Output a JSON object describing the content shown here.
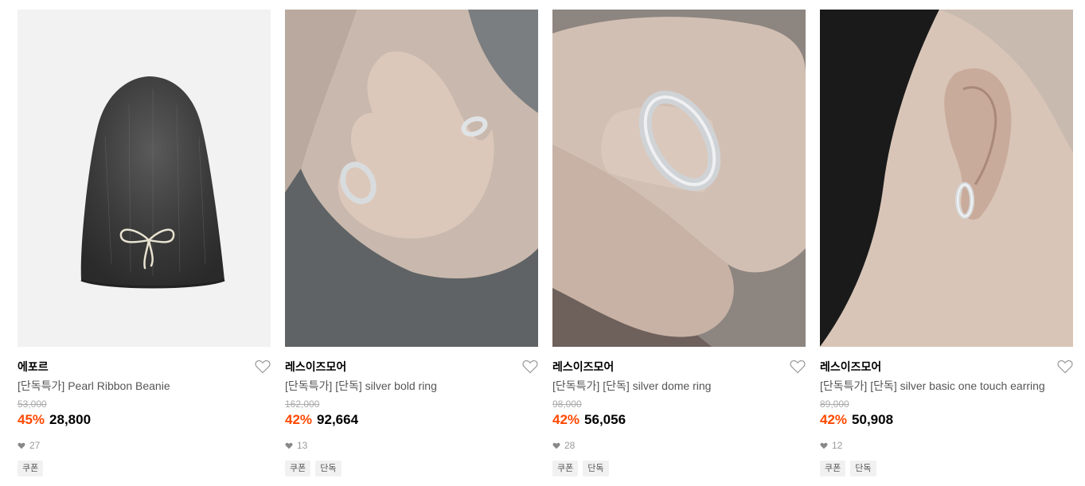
{
  "products": [
    {
      "brand": "에포르",
      "name": "[단독특가] Pearl Ribbon Beanie",
      "original_price": "53,000",
      "discount": "45%",
      "sale_price": "28,800",
      "likes": "27",
      "tags": [
        "쿠폰"
      ],
      "image_alt": "Charcoal fuzzy beanie with pearl ribbon"
    },
    {
      "brand": "레스이즈모어",
      "name": "[단독특가] [단독] silver bold ring",
      "original_price": "162,000",
      "discount": "42%",
      "sale_price": "92,664",
      "likes": "13",
      "tags": [
        "쿠폰",
        "단독"
      ],
      "image_alt": "Hand wearing silver rings on gray shirt"
    },
    {
      "brand": "레스이즈모어",
      "name": "[단독특가] [단독] silver dome ring",
      "original_price": "98,000",
      "discount": "42%",
      "sale_price": "56,056",
      "likes": "28",
      "tags": [
        "쿠폰",
        "단독"
      ],
      "image_alt": "Close-up of finger wearing silver dome ring"
    },
    {
      "brand": "레스이즈모어",
      "name": "[단독특가] [단독] silver basic one touch earring",
      "original_price": "89,000",
      "discount": "42%",
      "sale_price": "50,908",
      "likes": "12",
      "tags": [
        "쿠폰",
        "단독"
      ],
      "image_alt": "Ear wearing silver hoop earring"
    }
  ],
  "colors": {
    "discount": "#ff4800",
    "muted": "#999999",
    "tag_bg": "#f1f1f1"
  },
  "icons": {
    "like": "heart-outline-icon",
    "likes_count": "heart-filled-icon"
  }
}
